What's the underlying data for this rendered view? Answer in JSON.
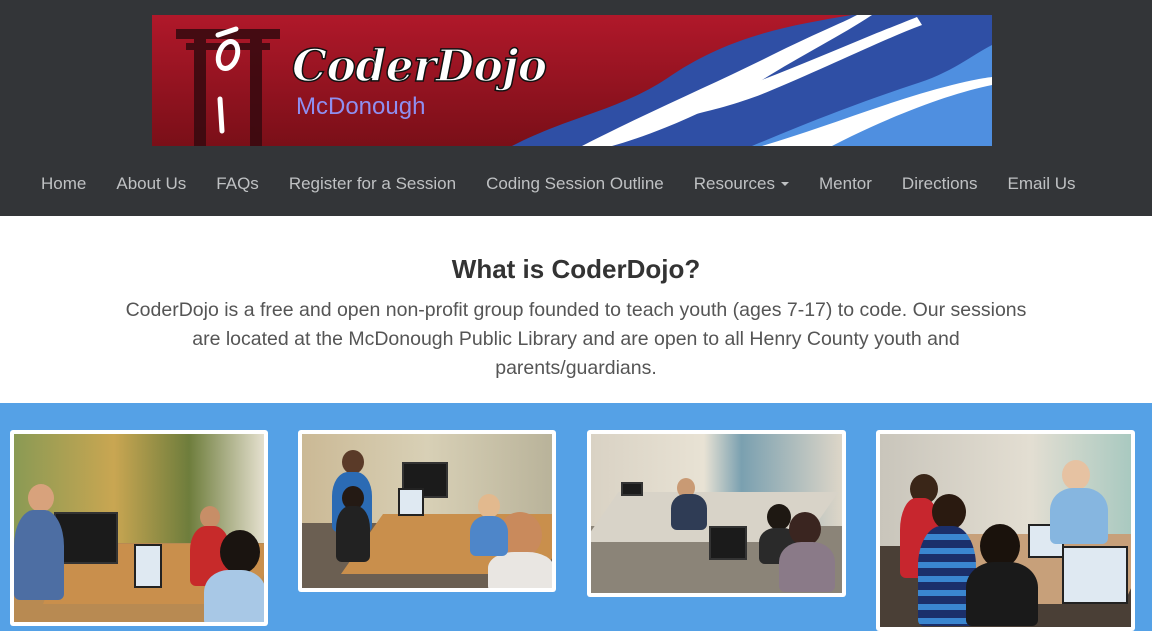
{
  "brand": {
    "name": "CoderDojo",
    "location": "McDonough",
    "colors": {
      "banner_red": "#9b1420",
      "banner_blue": "#2f4fa5",
      "accent_light_blue": "#55a1e6"
    }
  },
  "nav": {
    "items": [
      {
        "label": "Home"
      },
      {
        "label": "About Us"
      },
      {
        "label": "FAQs"
      },
      {
        "label": "Register for a Session"
      },
      {
        "label": "Coding Session Outline"
      },
      {
        "label": "Resources",
        "dropdown": true
      },
      {
        "label": "Mentor"
      },
      {
        "label": "Directions"
      },
      {
        "label": "Email Us"
      }
    ]
  },
  "intro": {
    "title": "What is CoderDojo?",
    "text": "CoderDojo is a free and open non-profit group founded to teach youth (ages 7-17) to code. Our sessions are located at the McDonough Public Library and are open to all Henry County youth and parents/guardians."
  },
  "photos": [
    {
      "subject": "photo-kids-coding-mural-room"
    },
    {
      "subject": "photo-kids-coding-library-table"
    },
    {
      "subject": "photo-meeting-room-laptops"
    },
    {
      "subject": "photo-mentor-helping-youth"
    }
  ]
}
